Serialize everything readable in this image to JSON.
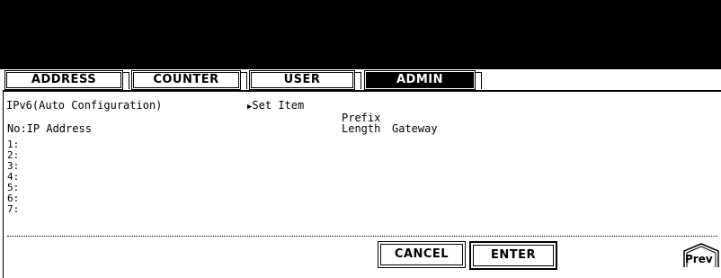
{
  "tabs": [
    {
      "label": "ADDRESS",
      "active": false
    },
    {
      "label": "COUNTER",
      "active": false
    },
    {
      "label": "USER",
      "active": false
    },
    {
      "label": "ADMIN",
      "active": true
    }
  ],
  "screen": {
    "title": "IPv6(Auto Configuration)",
    "set_item_arrow": "▶",
    "set_item_label": "Set Item"
  },
  "table": {
    "col_no_ip": "No:IP Address",
    "col_prefix_top": "Prefix",
    "col_prefix_bottom": "Length",
    "col_gateway": "Gateway",
    "rows": [
      "1:",
      "2:",
      "3:",
      "4:",
      "5:",
      "6:",
      "7:"
    ]
  },
  "buttons": {
    "cancel": "CANCEL",
    "enter": "ENTER",
    "prev": "Prev"
  }
}
